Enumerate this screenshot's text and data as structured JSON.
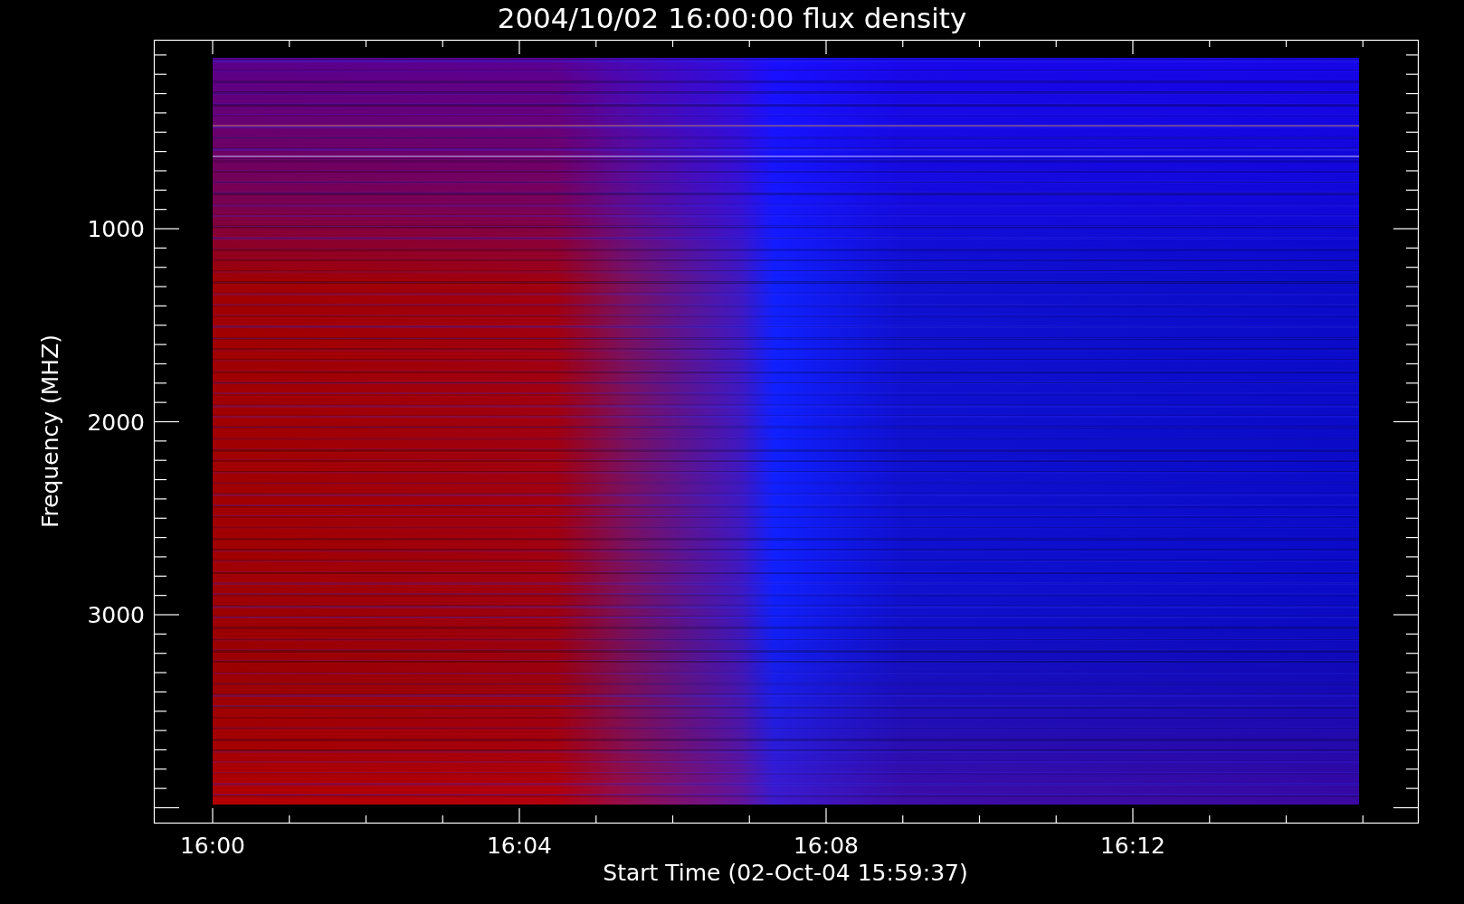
{
  "title": "2004/10/02 16:00:00 flux density",
  "x_axis": {
    "label": "Start Time (02-Oct-04 15:59:37)",
    "ticks": [
      "16:00",
      "16:04",
      "16:08",
      "16:12"
    ]
  },
  "y_axis": {
    "label": "Frequency (MHZ)",
    "ticks": [
      "1000",
      "2000",
      "3000"
    ]
  }
}
